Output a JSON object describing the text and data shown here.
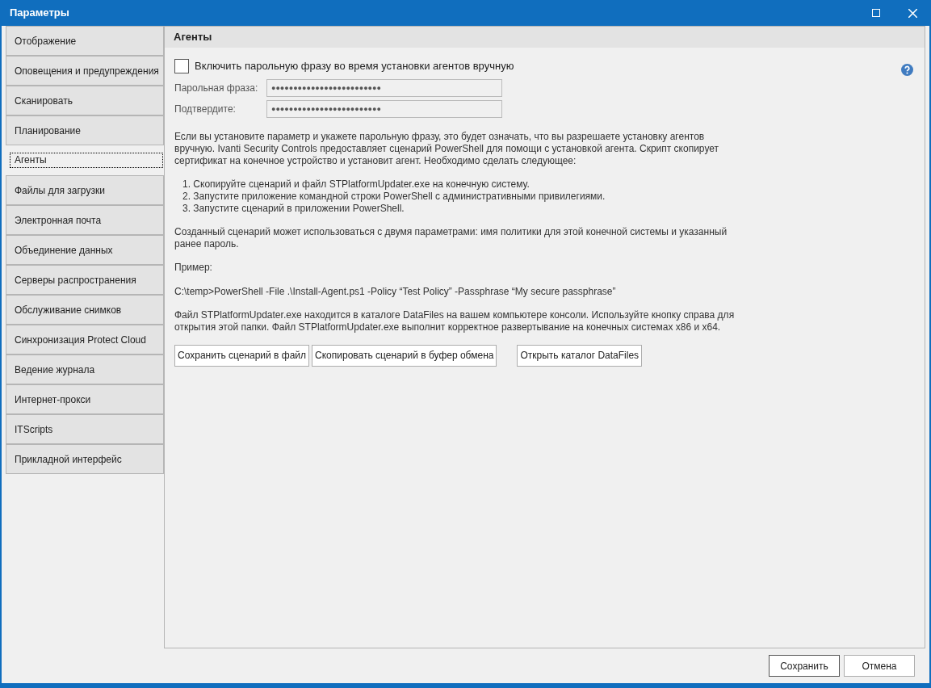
{
  "window": {
    "title": "Параметры"
  },
  "sidebar": {
    "items": [
      {
        "label": "Отображение",
        "selected": false
      },
      {
        "label": "Оповещения и предупреждения",
        "selected": false
      },
      {
        "label": "Сканировать",
        "selected": false
      },
      {
        "label": "Планирование",
        "selected": false
      },
      {
        "label": "Агенты",
        "selected": true
      },
      {
        "label": "Файлы для загрузки",
        "selected": false
      },
      {
        "label": "Электронная почта",
        "selected": false
      },
      {
        "label": "Объединение данных",
        "selected": false
      },
      {
        "label": "Серверы распространения",
        "selected": false
      },
      {
        "label": "Обслуживание снимков",
        "selected": false
      },
      {
        "label": "Синхронизация Protect Cloud",
        "selected": false
      },
      {
        "label": "Ведение журнала",
        "selected": false
      },
      {
        "label": "Интернет-прокси",
        "selected": false
      },
      {
        "label": "ITScripts",
        "selected": false
      },
      {
        "label": "Прикладной интерфейс",
        "selected": false
      }
    ]
  },
  "panel": {
    "title": "Агенты",
    "checkbox": {
      "label": "Включить парольную фразу во время установки агентов вручную",
      "checked": false
    },
    "fields": [
      {
        "label": "Парольная фраза:",
        "value": "●●●●●●●●●●●●●●●●●●●●●●●●●"
      },
      {
        "label": "Подтвердите:",
        "value": "●●●●●●●●●●●●●●●●●●●●●●●●●"
      }
    ],
    "intro": "Если вы установите параметр и укажете парольную фразу, это будет означать, что вы разрешаете установку агентов вручную. Ivanti Security Controls предоставляет сценарий PowerShell для помощи с установкой агента. Скрипт скопирует сертификат на конечное устройство и установит агент. Необходимо сделать следующее:",
    "steps": [
      "1. Скопируйте сценарий и файл STPlatformUpdater.exe на конечную систему.",
      "2. Запустите приложение командной строки PowerShell с административными привилегиями.",
      "3. Запустите сценарий в приложении PowerShell."
    ],
    "params_text": "Созданный сценарий может использоваться с двумя параметрами: имя политики для этой конечной системы и указанный ранее пароль.",
    "example_label": "Пример:",
    "example": "C:\\temp>PowerShell -File .\\Install-Agent.ps1 -Policy “Test Policy” -Passphrase “My secure passphrase”",
    "note": "Файл STPlatformUpdater.exe находится в каталоге DataFiles на вашем компьютере консоли. Используйте кнопку справа для открытия этой папки. Файл STPlatformUpdater.exe выполнит корректное развертывание на конечных системах x86 и x64.",
    "buttons": [
      "Сохранить сценарий в файл",
      "Скопировать сценарий в буфер обмена",
      "Открыть каталог DataFiles"
    ]
  },
  "footer": {
    "buttons": [
      {
        "label": "Сохранить",
        "default": true
      },
      {
        "label": "Отмена",
        "default": false
      }
    ]
  }
}
